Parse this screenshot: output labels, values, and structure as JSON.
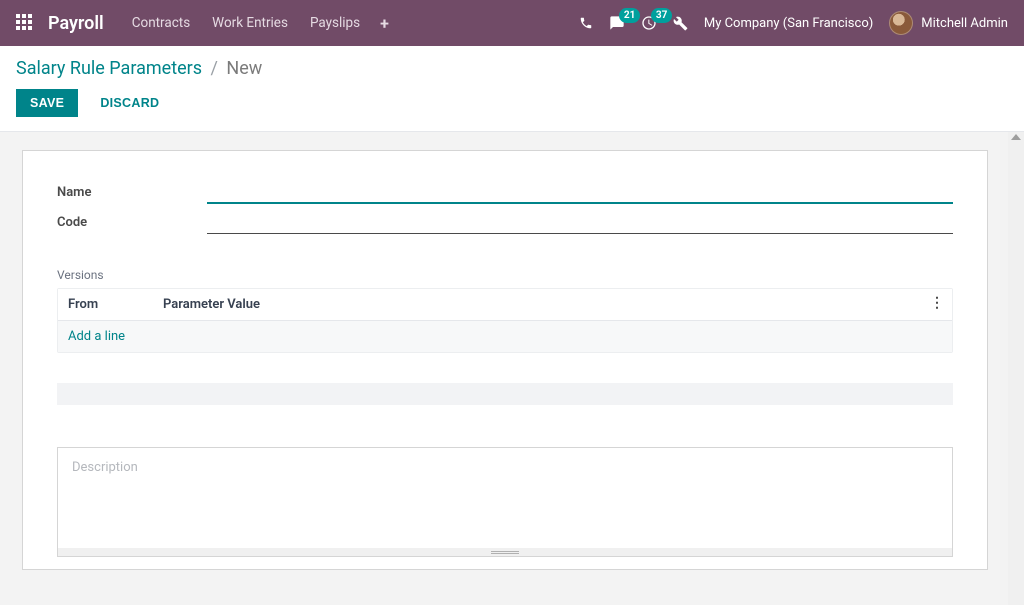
{
  "navbar": {
    "brand": "Payroll",
    "links": [
      "Contracts",
      "Work Entries",
      "Payslips"
    ],
    "messages_badge": "21",
    "activities_badge": "37",
    "company": "My Company (San Francisco)",
    "user": "Mitchell Admin"
  },
  "breadcrumb": {
    "parent": "Salary Rule Parameters",
    "current": "New"
  },
  "buttons": {
    "save": "SAVE",
    "discard": "DISCARD"
  },
  "form": {
    "name_label": "Name",
    "name_value": "",
    "code_label": "Code",
    "code_value": ""
  },
  "versions": {
    "section_label": "Versions",
    "col_from": "From",
    "col_value": "Parameter Value",
    "add_line": "Add a line"
  },
  "description": {
    "placeholder": "Description",
    "value": ""
  }
}
